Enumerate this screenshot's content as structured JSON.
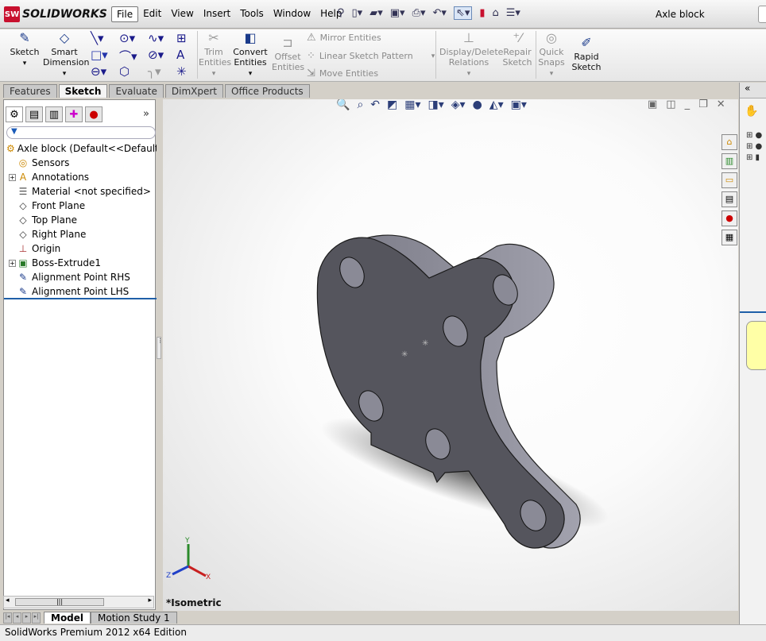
{
  "app": {
    "logo_text": "SOLIDWORKS",
    "document_title": "Axle block"
  },
  "menu": [
    "File",
    "Edit",
    "View",
    "Insert",
    "Tools",
    "Window",
    "Help"
  ],
  "command_manager": {
    "sketch": "Sketch",
    "smart_dimension_1": "Smart",
    "smart_dimension_2": "Dimension",
    "trim_1": "Trim",
    "trim_2": "Entities",
    "convert_1": "Convert",
    "convert_2": "Entities",
    "offset_1": "Offset",
    "offset_2": "Entities",
    "mirror": "Mirror Entities",
    "linear_pattern": "Linear Sketch Pattern",
    "move": "Move Entities",
    "display_relations_1": "Display/Delete",
    "display_relations_2": "Relations",
    "repair_1": "Repair",
    "repair_2": "Sketch",
    "quick_snaps_1": "Quick",
    "quick_snaps_2": "Snaps",
    "rapid_1": "Rapid",
    "rapid_2": "Sketch"
  },
  "tabs": [
    {
      "label": "Features",
      "active": false
    },
    {
      "label": "Sketch",
      "active": true
    },
    {
      "label": "Evaluate",
      "active": false
    },
    {
      "label": "DimXpert",
      "active": false
    },
    {
      "label": "Office Products",
      "active": false
    }
  ],
  "feature_tree": {
    "root": "Axle block  (Default<<Default>_",
    "items": [
      {
        "label": "Sensors",
        "icon": "sensor-icon",
        "expandable": false
      },
      {
        "label": "Annotations",
        "icon": "annotation-icon",
        "expandable": true
      },
      {
        "label": "Material <not specified>",
        "icon": "material-icon",
        "expandable": false
      },
      {
        "label": "Front Plane",
        "icon": "plane-icon",
        "expandable": false
      },
      {
        "label": "Top Plane",
        "icon": "plane-icon",
        "expandable": false
      },
      {
        "label": "Right Plane",
        "icon": "plane-icon",
        "expandable": false
      },
      {
        "label": "Origin",
        "icon": "origin-icon",
        "expandable": false
      },
      {
        "label": "Boss-Extrude1",
        "icon": "extrude-icon",
        "expandable": true
      },
      {
        "label": "Alignment Point RHS",
        "icon": "sketch-icon",
        "expandable": false
      },
      {
        "label": "Alignment Point LHS",
        "icon": "sketch-icon",
        "expandable": false
      }
    ]
  },
  "viewport": {
    "view_label": "*Isometric",
    "triad": {
      "x": "X",
      "y": "Y",
      "z": "Z"
    }
  },
  "bottom_tabs": [
    {
      "label": "Model",
      "active": true
    },
    {
      "label": "Motion Study 1",
      "active": false
    }
  ],
  "status_bar": "SolidWorks Premium 2012 x64 Edition",
  "colors": {
    "part_face": "#5b5b62",
    "part_side": "#8a8a96",
    "accent": "#c8102e"
  }
}
